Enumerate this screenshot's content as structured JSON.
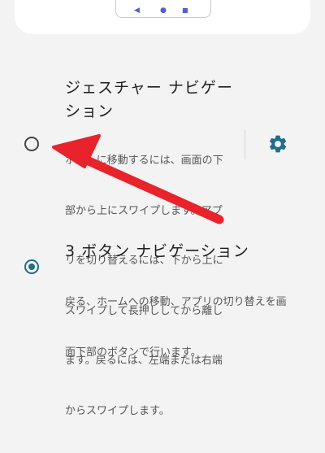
{
  "preview": {
    "back_icon": "◀",
    "home_icon": "●",
    "recents_icon": "■"
  },
  "gesture_option": {
    "title_line1": "ジェスチャー ナビゲー",
    "title_line2": "ション",
    "description_lines": [
      "ホームに移動するには、画面の下",
      "部から上にスワイプします。アプ",
      "リを切り替えるには、下から上に",
      "スワイプして長押ししてから離し",
      "ます。戻るには、左端または右端",
      "からスワイプします。"
    ],
    "selected": false,
    "settings_icon": "gear-icon"
  },
  "three_button_option": {
    "title": "3 ボタン ナビゲーション",
    "description_lines": [
      "戻る、ホームへの移動、アプリの切り替えを画",
      "面下部のボタンで行います。"
    ],
    "selected": true
  },
  "colors": {
    "accent": "#1e6e8c",
    "annotation_arrow": "#e8232b",
    "background": "#f3f3f3"
  }
}
